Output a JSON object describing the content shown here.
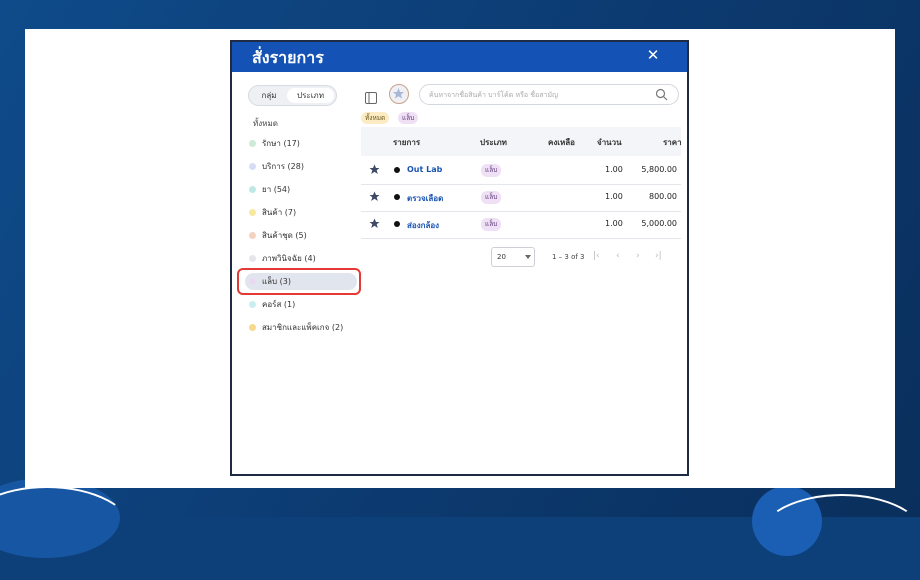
{
  "modal": {
    "title": "สั่งรายการ",
    "close": "✕"
  },
  "view_toggle": {
    "group": "กลุ่ม",
    "type": "ประเภท",
    "selected": "ประเภท"
  },
  "sidebar": {
    "all_label": "ทั้งหมด",
    "items": [
      {
        "label": "รักษา (17)",
        "color": "#cfe9d9"
      },
      {
        "label": "บริการ (28)",
        "color": "#d6dcf6"
      },
      {
        "label": "ยา (54)",
        "color": "#bfe7e3"
      },
      {
        "label": "สินค้า (7)",
        "color": "#f8e8a0"
      },
      {
        "label": "สินค้าชุด (5)",
        "color": "#f3d3bf"
      },
      {
        "label": "ภาพวินิจฉัย (4)",
        "color": "#e4e6ea"
      },
      {
        "label": "แล็บ (3)",
        "color": "#ead9f3",
        "active": true
      },
      {
        "label": "คอร์ส (1)",
        "color": "#c9eef0"
      },
      {
        "label": "สมาชิกและแพ็คเกจ (2)",
        "color": "#f7d98e"
      }
    ]
  },
  "search": {
    "placeholder": "ค้นหาจากชื่อสินค้า บาร์โค้ด หรือ ชื่อสามัญ"
  },
  "filters": {
    "all": "ทั้งหมด",
    "lab": "แล็บ"
  },
  "table": {
    "headers": [
      "รายการ",
      "ประเภท",
      "คงเหลือ",
      "จำนวน",
      "ราคา"
    ],
    "rows": [
      {
        "name": "Out Lab",
        "type": "แล็บ",
        "stock": "",
        "qty": "1.00",
        "price": "5,800.00"
      },
      {
        "name": "ตรวจเลือด",
        "type": "แล็บ",
        "stock": "",
        "qty": "1.00",
        "price": "800.00"
      },
      {
        "name": "ส่องกล้อง",
        "type": "แล็บ",
        "stock": "",
        "qty": "1.00",
        "price": "5,000.00"
      }
    ]
  },
  "pagination": {
    "page_size": "20",
    "range": "1 – 3 of 3"
  },
  "colors": {
    "header": "#1453b5",
    "link": "#1c55b4",
    "highlight": "#e53935",
    "background": "#0d3f78"
  }
}
